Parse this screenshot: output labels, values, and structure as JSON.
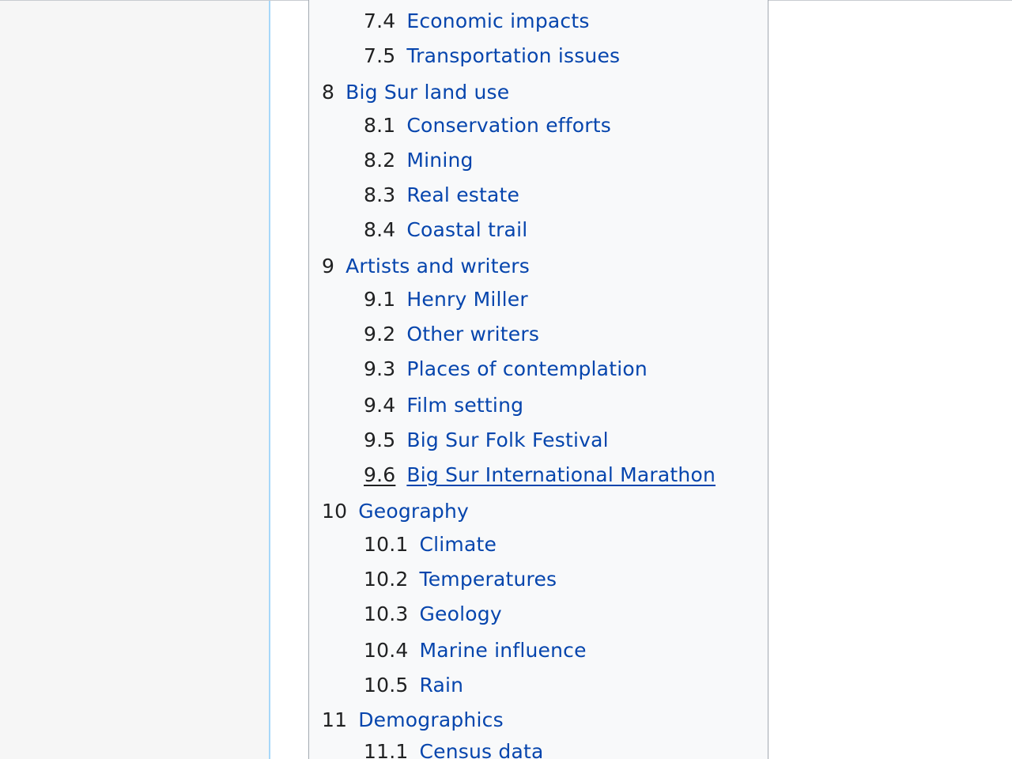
{
  "toc": {
    "items": [
      {
        "number": "7.4",
        "text": "Economic impacts",
        "level": 2
      },
      {
        "number": "7.5",
        "text": "Transportation issues",
        "level": 2
      },
      {
        "number": "8",
        "text": "Big Sur land use",
        "level": 1
      },
      {
        "number": "8.1",
        "text": "Conservation efforts",
        "level": 2
      },
      {
        "number": "8.2",
        "text": "Mining",
        "level": 2
      },
      {
        "number": "8.3",
        "text": "Real estate",
        "level": 2
      },
      {
        "number": "8.4",
        "text": "Coastal trail",
        "level": 2
      },
      {
        "number": "9",
        "text": "Artists and writers",
        "level": 1
      },
      {
        "number": "9.1",
        "text": "Henry Miller",
        "level": 2
      },
      {
        "number": "9.2",
        "text": "Other writers",
        "level": 2
      },
      {
        "number": "9.3",
        "text": "Places of contemplation",
        "level": 2
      },
      {
        "number": "9.4",
        "text": "Film setting",
        "level": 2
      },
      {
        "number": "9.5",
        "text": "Big Sur Folk Festival",
        "level": 2
      },
      {
        "number": "9.6",
        "text": "Big Sur International Marathon",
        "level": 2,
        "hovered": true
      },
      {
        "number": "10",
        "text": "Geography",
        "level": 1
      },
      {
        "number": "10.1",
        "text": "Climate",
        "level": 2
      },
      {
        "number": "10.2",
        "text": "Temperatures",
        "level": 2
      },
      {
        "number": "10.3",
        "text": "Geology",
        "level": 2
      },
      {
        "number": "10.4",
        "text": "Marine influence",
        "level": 2
      },
      {
        "number": "10.5",
        "text": "Rain",
        "level": 2
      },
      {
        "number": "11",
        "text": "Demographics",
        "level": 1
      },
      {
        "number": "11.1",
        "text": "Census data",
        "level": 2
      }
    ]
  },
  "colors": {
    "link": "#0645ad",
    "text": "#202122",
    "toc_background": "#f8f9fa",
    "left_panel_background": "#f6f6f6",
    "panel_border": "#a7d7f9"
  }
}
